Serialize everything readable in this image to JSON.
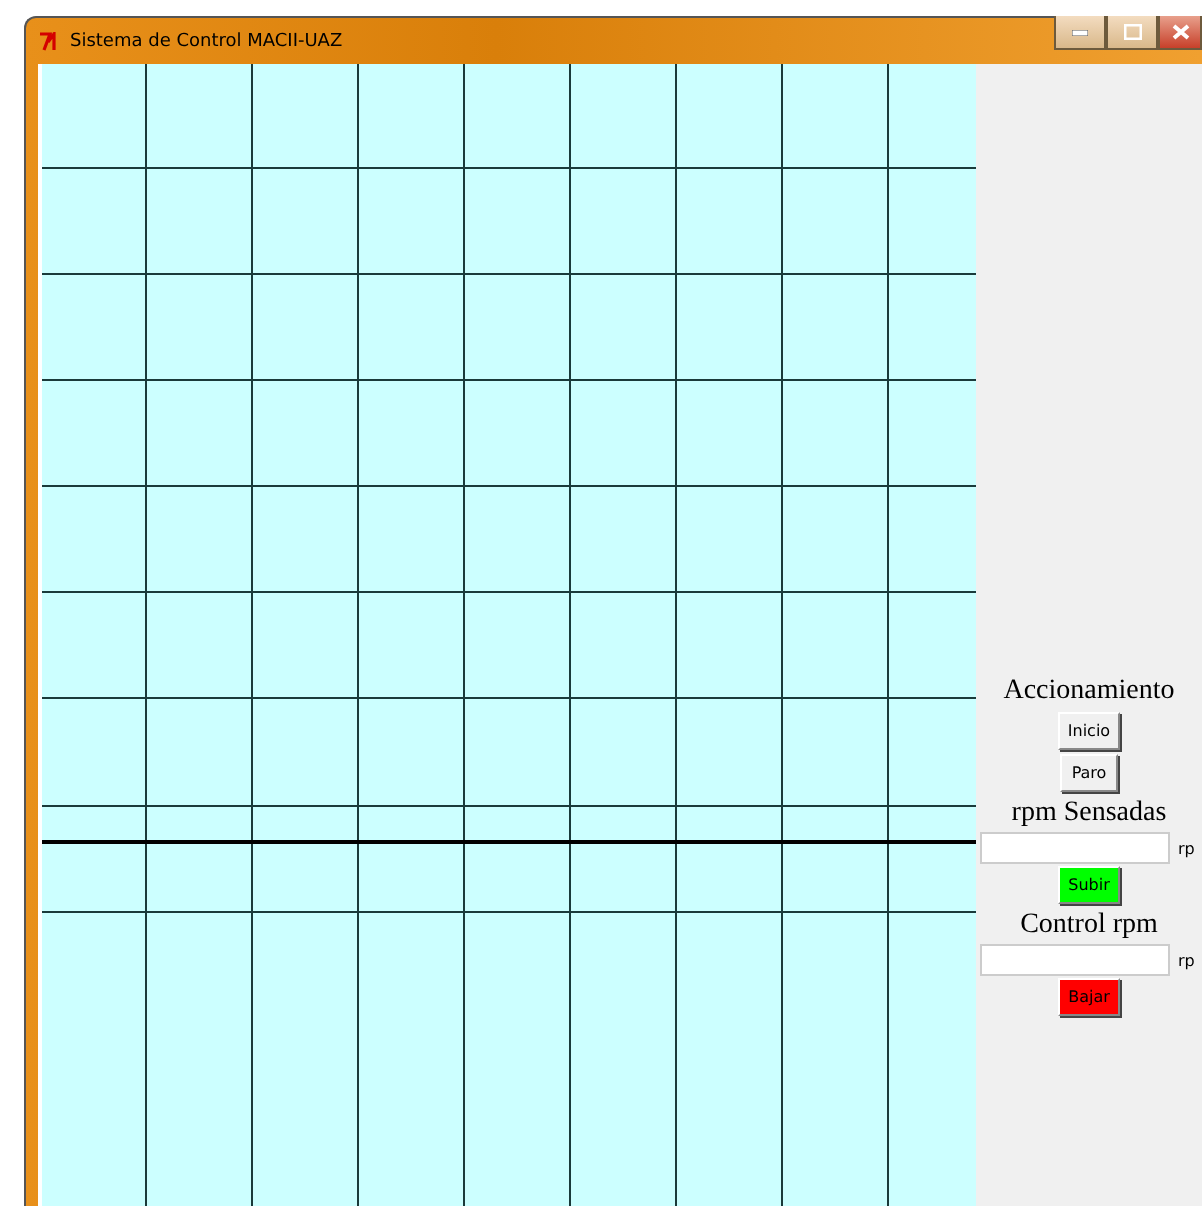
{
  "window": {
    "title": "Sistema de Control MACII-UAZ"
  },
  "panel": [
    {
      "kind": "heading",
      "text": "Accionamiento"
    },
    {
      "kind": "button",
      "label": "Inicio"
    },
    {
      "kind": "button",
      "label": "Paro"
    },
    {
      "kind": "heading",
      "text": "rpm Sensadas"
    },
    {
      "kind": "field",
      "unit": "rp"
    },
    {
      "kind": "button",
      "label": "Subir",
      "color": "#00ff00"
    },
    {
      "kind": "heading",
      "text": "Control rpm"
    },
    {
      "kind": "field",
      "unit": "rp"
    },
    {
      "kind": "button",
      "label": "Bajar",
      "color": "#ff0000"
    }
  ]
}
